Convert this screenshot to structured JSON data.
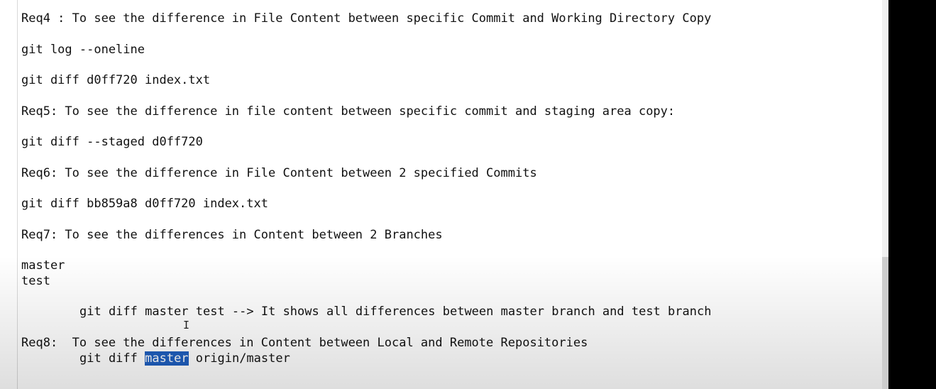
{
  "document": {
    "lines": [
      "Req4 : To see the difference in File Content between specific Commit and Working Directory Copy",
      "git log --oneline",
      "git diff d0ff720 index.txt",
      "Req5: To see the difference in file content between specific commit and staging area copy:",
      "git diff --staged d0ff720",
      "Req6: To see the difference in File Content between 2 specified Commits",
      "git diff bb859a8 d0ff720 index.txt",
      "Req7: To see the differences in Content between 2 Branches",
      "master",
      "test",
      "git diff master test --> It shows all differences between master branch and test branch",
      "Req8:  To see the differences in Content between Local and Remote Repositories"
    ],
    "last_line": {
      "prefix": "git diff ",
      "selected": "master",
      "suffix": " origin/master"
    },
    "cursor_glyph": "I"
  },
  "colors": {
    "selection": "#1f5fbf",
    "text": "#111111",
    "background": "#ffffff"
  }
}
